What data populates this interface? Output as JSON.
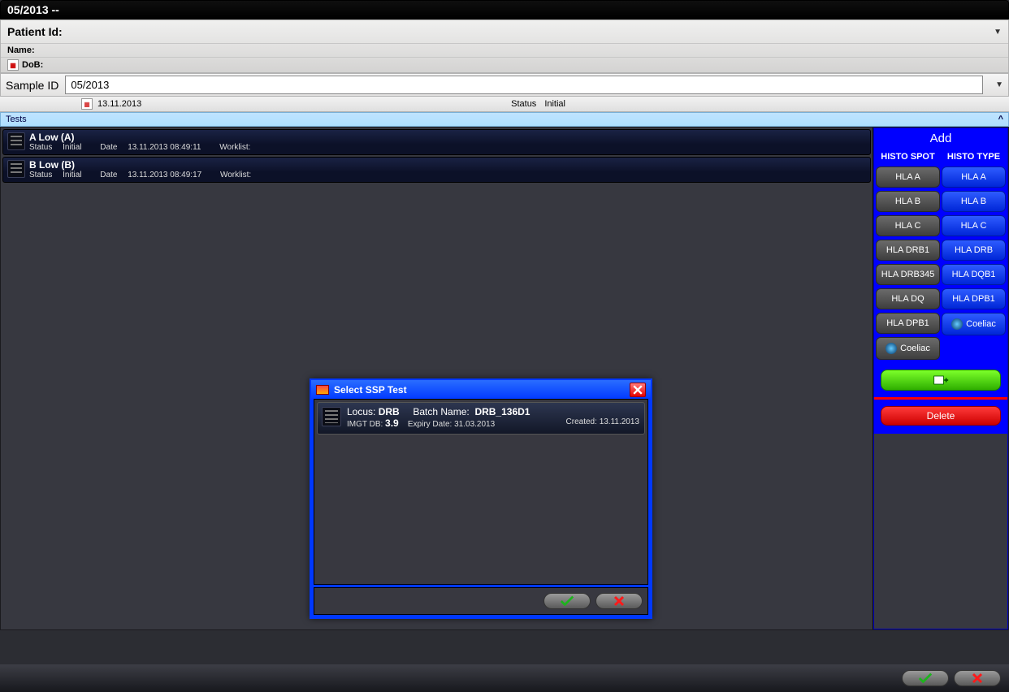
{
  "title_bar": "05/2013 --",
  "patient": {
    "id_label": "Patient Id:",
    "name_label": "Name:",
    "dob_label": "DoB:"
  },
  "sample": {
    "label": "Sample ID",
    "value": "05/2013",
    "date": "13.11.2013",
    "status_label": "Status",
    "status_value": "Initial"
  },
  "tests_header": "Tests",
  "tests": [
    {
      "title": "A Low  (A)",
      "status_label": "Status",
      "status_value": "Initial",
      "date_label": "Date",
      "date_value": "13.11.2013 08:49:11",
      "worklist_label": "Worklist:"
    },
    {
      "title": "B Low  (B)",
      "status_label": "Status",
      "status_value": "Initial",
      "date_label": "Date",
      "date_value": "13.11.2013 08:49:17",
      "worklist_label": "Worklist:"
    }
  ],
  "add_panel": {
    "title": "Add",
    "col_headers": [
      "HISTO SPOT",
      "HISTO TYPE"
    ],
    "col1": [
      "HLA A",
      "HLA B",
      "HLA C",
      "HLA DRB1",
      "HLA DRB345",
      "HLA DQ",
      "HLA DPB1",
      "Coeliac"
    ],
    "col2": [
      "HLA A",
      "HLA B",
      "HLA C",
      "HLA DRB",
      "HLA DQB1",
      "HLA DPB1",
      "Coeliac"
    ],
    "delete_label": "Delete"
  },
  "modal": {
    "title": "Select SSP Test",
    "item": {
      "locus_label": "Locus:",
      "locus_value": "DRB",
      "batch_label": "Batch Name:",
      "batch_value": "DRB_136D1",
      "imgt_label": "IMGT DB:",
      "imgt_value": "3.9",
      "expiry_label": "Expiry Date:",
      "expiry_value": "31.03.2013",
      "created_label": "Created:",
      "created_value": "13.11.2013"
    }
  }
}
